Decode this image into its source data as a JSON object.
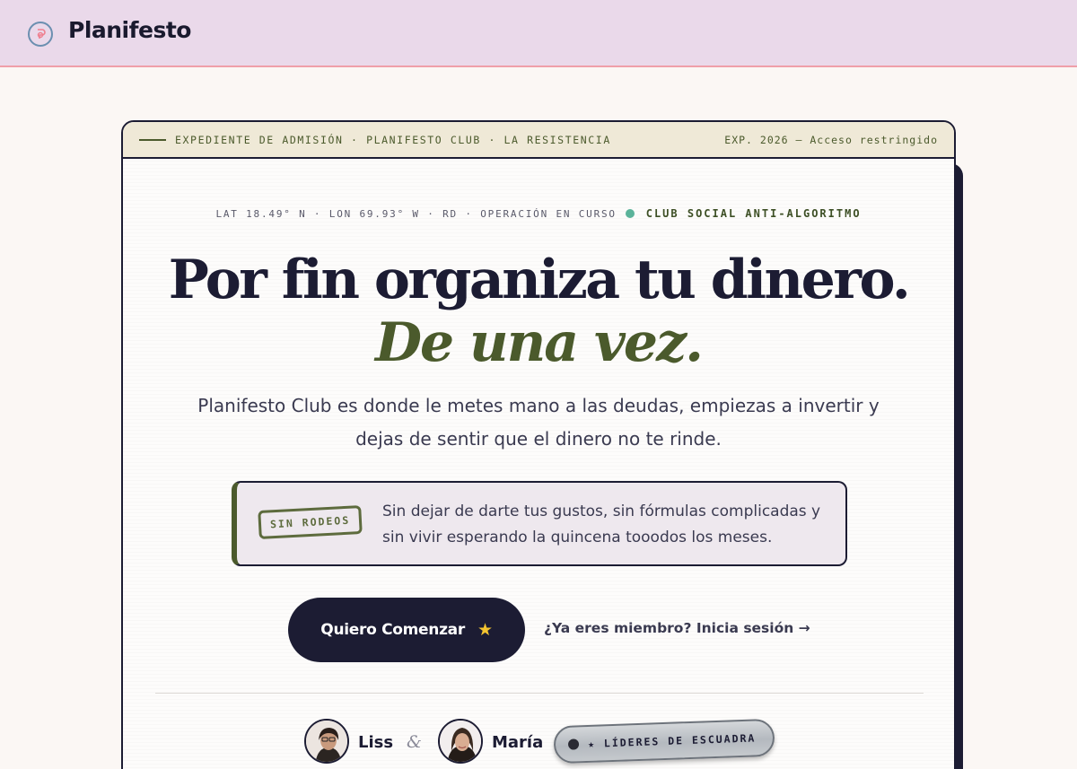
{
  "app": {
    "brand": "Planifesto"
  },
  "card": {
    "header_left": "EXPEDIENTE DE ADMISIÓN · PLANIFESTO CLUB · LA RESISTENCIA",
    "header_right": "EXP. 2026 — Acceso restringido",
    "coords": "LAT 18.49° N · LON 69.93° W · RD · OPERACIÓN EN CURSO",
    "club_tag": "CLUB SOCIAL ANTI-ALGORITMO",
    "headline": "Por fin organiza tu dinero.",
    "subline": "De una vez.",
    "lead": "Planifesto Club es donde le metes mano a las deudas, empiezas a invertir y dejas de sentir que el dinero no te rinde.",
    "stamp": "SIN RODEOS",
    "note": "Sin dejar de darte tus gustos, sin fórmulas complicadas y sin vivir esperando la quincena tooodos los meses.",
    "cta_label": "Quiero Comenzar",
    "cta_icon": "star-icon",
    "login_link": "¿Ya eres miembro? Inicia sesión →",
    "leaders": {
      "first": "Liss",
      "amp": "&",
      "second": "María",
      "badge": "★ LÍDERES DE ESCUADRA"
    }
  },
  "colors": {
    "topbar_bg": "#ead9ea",
    "topbar_border": "#ef9fa9",
    "ink": "#1c1c33",
    "olive": "#4b5a2c",
    "highlight": "#bccba2",
    "note_bg": "#eee8ee",
    "status_dot": "#5bb39a",
    "star": "#f4c430"
  }
}
